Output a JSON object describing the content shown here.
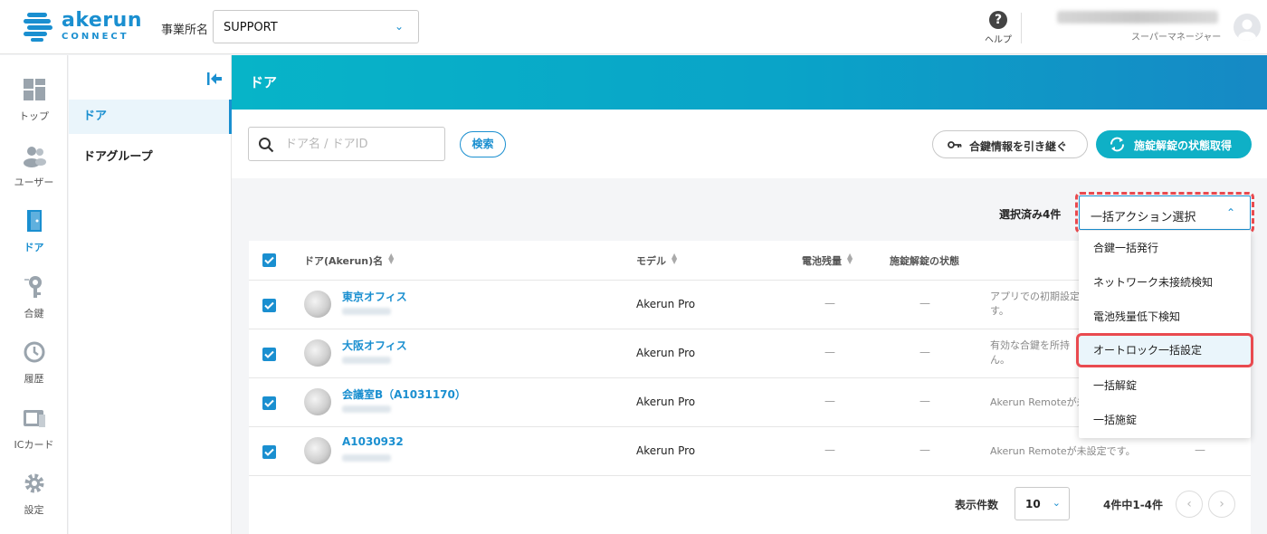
{
  "brand": {
    "name": "akerun",
    "sub": "CONNECT"
  },
  "header": {
    "office_label": "事業所名",
    "office_value": "SUPPORT",
    "help_label": "ヘルプ",
    "user_name": "",
    "user_role": "スーパーマネージャー"
  },
  "rail": {
    "top": "トップ",
    "users": "ユーザー",
    "door": "ドア",
    "key": "合鍵",
    "history": "履歴",
    "iccard": "ICカード",
    "settings": "設定"
  },
  "subnav": {
    "door": "ドア",
    "door_group": "ドアグループ"
  },
  "banner": {
    "title": "ドア"
  },
  "toolbar": {
    "search_placeholder": "ドア名 / ドアID",
    "search_button": "検索",
    "inherit_button": "合鍵情報を引き継ぐ",
    "status_button": "施錠解錠の状態取得"
  },
  "selection": {
    "count_label": "選択済み4件",
    "bulk_select_value": "一括アクション選択"
  },
  "table": {
    "headers": {
      "name": "ドア(Akerun)名",
      "model": "モデル",
      "battery": "電池残量",
      "lock_state": "施錠解錠の状態"
    },
    "rows": [
      {
        "name": "東京オフィス",
        "model": "Akerun Pro",
        "battery": "—",
        "lock_state": "—",
        "remark": "アプリでの初期設定",
        "remark2": "す。",
        "checked": true
      },
      {
        "name": "大阪オフィス",
        "model": "Akerun Pro",
        "battery": "—",
        "lock_state": "—",
        "remark": "有効な合鍵を所持",
        "remark2": "ん。",
        "checked": true
      },
      {
        "name": "会議室B（A1031170）",
        "model": "Akerun Pro",
        "battery": "—",
        "lock_state": "—",
        "remark": "Akerun Remoteが未",
        "remark2": "",
        "checked": true
      },
      {
        "name": "A1030932",
        "model": "Akerun Pro",
        "battery": "—",
        "lock_state": "—",
        "remark": "Akerun Remoteが未設定です。",
        "remark2": "",
        "extra": "—",
        "checked": true
      }
    ]
  },
  "pagination": {
    "per_page_label": "表示件数",
    "per_page_value": "10",
    "info": "4件中1-4件"
  },
  "menu": {
    "items": [
      "合鍵一括発行",
      "ネットワーク未接続検知",
      "電池残量低下検知",
      "オートロック一括設定",
      "一括解錠",
      "一括施錠"
    ],
    "highlighted_index": 3
  },
  "colors": {
    "accent": "#1a8fd0",
    "banner": "#07b4c8",
    "highlight": "#e94a4f"
  }
}
